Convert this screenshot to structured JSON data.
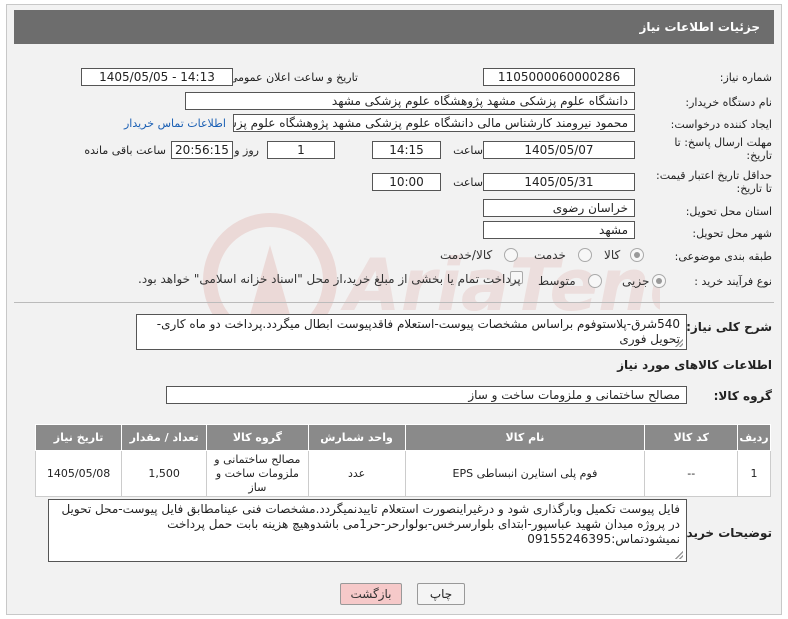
{
  "header": {
    "title": "جزئیات اطلاعات نیاز"
  },
  "fields": {
    "need_number": {
      "label": "شماره نیاز:",
      "value": "1105000060000286"
    },
    "announce": {
      "label": "تاریخ و ساعت اعلان عمومی:",
      "value": "1405/05/05 - 14:13"
    },
    "buyer_org": {
      "label": "نام دستگاه خریدار:",
      "value": "دانشگاه علوم پزشکی مشهد   پژوهشگاه علوم پزشکی مشهد"
    },
    "requester": {
      "label": "ایجاد کننده درخواست:",
      "value": "محمود نیرومند کارشناس مالی دانشگاه علوم پزشکی مشهد   پژوهشگاه علوم پزشکی مشهد",
      "contact_link": "اطلاعات تماس خریدار"
    },
    "deadline": {
      "label_line1": "مهلت ارسال پاسخ: تا",
      "label_line2": "تاریخ:",
      "date": "1405/05/07",
      "time_label": "ساعت",
      "time": "14:15",
      "days": "1",
      "days_label": "روز و",
      "remaining": "20:56:15",
      "remaining_label": "ساعت باقی مانده"
    },
    "price_validity": {
      "label_line1": "حداقل تاریخ اعتبار قیمت:",
      "label_line2": "تا تاریخ:",
      "date": "1405/05/31",
      "time_label": "ساعت",
      "time": "10:00"
    },
    "province": {
      "label": "استان محل تحویل:",
      "value": "خراسان رضوی"
    },
    "city": {
      "label": "شهر محل تحویل:",
      "value": "مشهد"
    },
    "category": {
      "label": "طبقه بندی موضوعی:",
      "options": [
        "کالا",
        "خدمت",
        "کالا/خدمت"
      ],
      "selected": 0
    },
    "process": {
      "label": "نوع فرآیند خرید :",
      "options": [
        "جزیی",
        "متوسط"
      ],
      "checkbox_text": "پرداخت تمام یا بخشی از مبلغ خرید،از محل \"اسناد خزانه اسلامی\" خواهد بود."
    }
  },
  "description": {
    "label": "شرح کلی نیاز:",
    "text": "540شرق-پلاستوفوم براساس مشخصات پیوست-استعلام فاقدپیوست ابطال میگردد.پرداخت دو ماه کاری-تحویل فوری"
  },
  "goods_info": {
    "section_title": "اطلاعات کالاهای مورد نیاز",
    "group_label": "گروه کالا:",
    "group_value": "مصالح ساختمانی و ملزومات ساخت و ساز",
    "columns": [
      "ردیف",
      "کد کالا",
      "نام کالا",
      "واحد شمارش",
      "گروه کالا",
      "تعداد / مقدار",
      "تاریخ نیاز"
    ],
    "rows": [
      {
        "row": "1",
        "code": "--",
        "name": "فوم پلی استایرن انبساطی EPS",
        "unit": "عدد",
        "group": "مصالح ساختمانی و ملزومات ساخت و ساز",
        "qty": "1,500",
        "date": "1405/05/08"
      }
    ]
  },
  "buyer_notes": {
    "label": "توضیحات خریدار:",
    "text": "فایل پیوست تکمیل وبارگذاری شود و درغیراینصورت استعلام تاییدنمیگردد.مشخصات فنی عینامطابق فایل پیوست-محل تحویل در پروژه میدان شهید عباسپور-ابتدای بلوارسرخس-بولوارحر-حر1می باشدوهیچ هزینه بابت حمل  پرداخت نمیشودتماس:09155246395"
  },
  "buttons": {
    "print": "چاپ",
    "back": "بازگشت"
  },
  "colors": {
    "title_bar": "#6d6d6d",
    "table_header": "#8a8a8a",
    "back_button": "#f6c9c9",
    "link": "#1a5fb4"
  }
}
